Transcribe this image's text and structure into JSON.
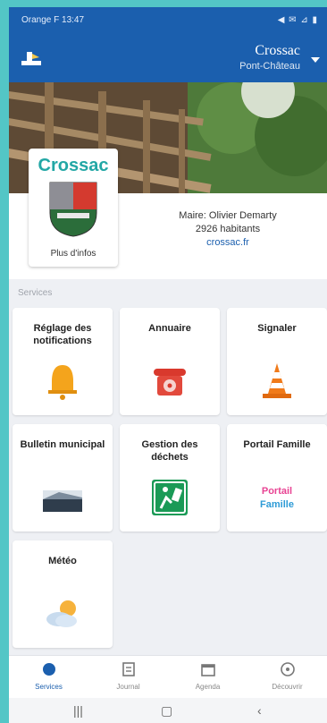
{
  "status": {
    "left": "Orange F 13:47",
    "right": "◀ ✉ ⊿ ▮"
  },
  "header": {
    "city": "Crossac",
    "region": "Pont-Château"
  },
  "commune": {
    "crest_title": "Crossac",
    "more_info": "Plus d'infos",
    "mayor": "Maire: Olivier Demarty",
    "population": "2926 habitants",
    "website": "crossac.fr"
  },
  "section_label": "Services",
  "tiles": [
    {
      "label": "Réglage des notifications",
      "icon": "bell-icon"
    },
    {
      "label": "Annuaire",
      "icon": "telephone-icon"
    },
    {
      "label": "Signaler",
      "icon": "traffic-cone-icon"
    },
    {
      "label": "Bulletin municipal",
      "icon": "bulletin-icon"
    },
    {
      "label": "Gestion des déchets",
      "icon": "waste-icon"
    },
    {
      "label": "Portail Famille",
      "icon": "portail-famille-logo"
    },
    {
      "label": "Météo",
      "icon": "weather-icon"
    }
  ],
  "bottom_nav": [
    {
      "label": "Services",
      "icon": "services-icon",
      "active": true
    },
    {
      "label": "Journal",
      "icon": "journal-icon",
      "active": false
    },
    {
      "label": "Agenda",
      "icon": "agenda-icon",
      "active": false
    },
    {
      "label": "Découvrir",
      "icon": "discover-icon",
      "active": false
    }
  ],
  "portail_logo_text": [
    "Portail",
    "Famille"
  ],
  "colors": {
    "primary": "#1b5fae",
    "accent": "#23a7a5",
    "background": "#53c6c6"
  }
}
